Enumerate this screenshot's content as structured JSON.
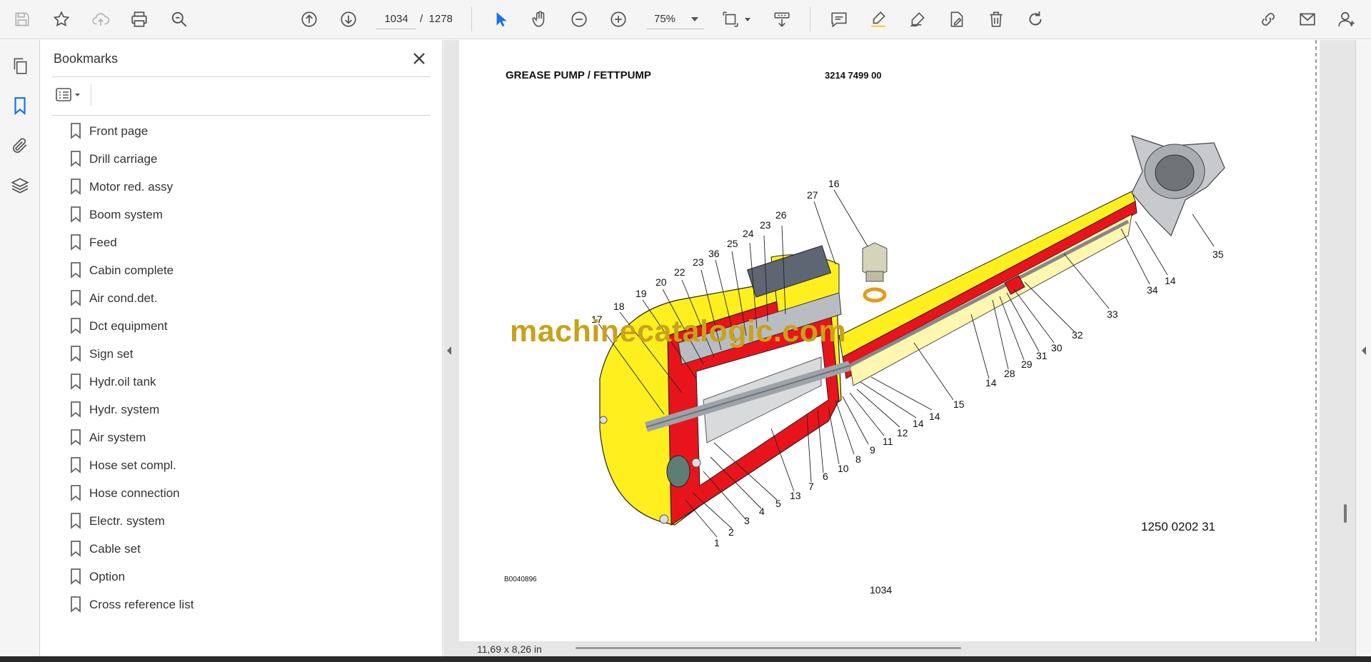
{
  "toolbar": {
    "current_page": "1034",
    "separator": "/",
    "total_pages": "1278",
    "zoom": "75%",
    "icons": [
      "save-icon",
      "star-icon",
      "cloud-upload-icon",
      "print-icon",
      "zoom-search-icon",
      "page-up-icon",
      "page-down-icon",
      "select-cursor-icon",
      "hand-icon",
      "zoom-out-icon",
      "zoom-in-icon",
      "page-fit-icon",
      "scroll-mode-icon",
      "comment-icon",
      "highlight-icon",
      "sign-icon",
      "edit-pdf-icon",
      "delete-icon",
      "rotate-icon",
      "share-link-icon",
      "email-icon",
      "add-user-icon"
    ]
  },
  "rail": {
    "icons": [
      "pages-icon",
      "bookmark-icon",
      "attachment-icon",
      "layers-icon"
    ]
  },
  "bookmarks": {
    "title": "Bookmarks",
    "items": [
      "Front page",
      "Drill carriage",
      "Motor red. assy",
      "Boom system",
      "Feed",
      "Cabin complete",
      "Air cond.det.",
      "Dct equipment",
      "Sign set",
      "Hydr.oil tank",
      "Hydr. system",
      "Air system",
      "Hose set compl.",
      "Hose connection",
      "Electr. system",
      "Cable set",
      "Option",
      "Cross reference list"
    ]
  },
  "document": {
    "title": "GREASE PUMP / FETTPUMP",
    "part_number": "3214 7499 00",
    "drawing_number": "1250 0202 31",
    "small_code": "B0040896",
    "page_number": "1034",
    "watermark": "machinecatalogic.com",
    "callouts": [
      "1",
      "2",
      "3",
      "4",
      "5",
      "6",
      "7",
      "8",
      "9",
      "10",
      "11",
      "12",
      "13",
      "14",
      "14",
      "14",
      "14",
      "15",
      "16",
      "17",
      "18",
      "19",
      "20",
      "22",
      "23",
      "23",
      "24",
      "25",
      "26",
      "27",
      "28",
      "29",
      "30",
      "31",
      "32",
      "33",
      "34",
      "35",
      "36"
    ],
    "colors": {
      "housing_red": "#e8141b",
      "cavity_yellow": "#ffef1f",
      "tube_cream": "#fff6b0",
      "steel_grey": "#9ea3aa"
    }
  },
  "status": {
    "page_size": "11,69 x 8,26 in"
  }
}
